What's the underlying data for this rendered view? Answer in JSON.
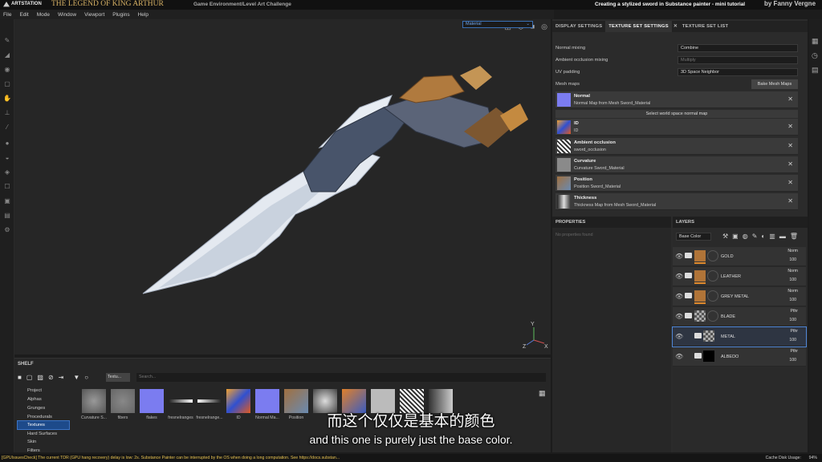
{
  "title_bar": {
    "brand": "ARTSTATION",
    "show": "THE LEGEND OF KING ARTHUR",
    "subtitle": "Game Environment/Level Art Challenge",
    "tutorial": "Creating a stylized sword in Substance painter - mini tutorial",
    "author": "by Fanny Vergne"
  },
  "menu": [
    "File",
    "Edit",
    "Mode",
    "Window",
    "Viewport",
    "Plugins",
    "Help"
  ],
  "viewport": {
    "material_select": "Material"
  },
  "tabs": {
    "display": "DISPLAY SETTINGS",
    "texture_set": "TEXTURE SET SETTINGS",
    "texture_list": "TEXTURE SET LIST"
  },
  "settings": {
    "normal_mixing": {
      "label": "Normal mixing",
      "value": "Combine"
    },
    "ao_mixing": {
      "label": "Ambient occlusion mixing",
      "value": "Multiply"
    },
    "uv_padding": {
      "label": "UV padding",
      "value": "3D Space Neighbor"
    },
    "mesh_maps_label": "Mesh maps",
    "bake_button": "Bake Mesh Maps",
    "world_space_button": "Select world space normal map"
  },
  "mesh_maps": [
    {
      "title": "Normal",
      "sub": "Normal Map from Mesh Sword_Material"
    },
    {
      "title": "ID",
      "sub": "ID"
    },
    {
      "title": "Ambient occlusion",
      "sub": "sword_occlusion"
    },
    {
      "title": "Curvature",
      "sub": "Curvature Sword_Material"
    },
    {
      "title": "Position",
      "sub": "Position Sword_Material"
    },
    {
      "title": "Thickness",
      "sub": "Thickness Map from Mesh Sword_Material"
    }
  ],
  "properties": {
    "header": "PROPERTIES",
    "empty": "No properties found"
  },
  "layers": {
    "header": "LAYERS",
    "channel": "Base Color",
    "items": [
      {
        "name": "GOLD",
        "blend": "Norm",
        "opacity": "100"
      },
      {
        "name": "LEATHER",
        "blend": "Norm",
        "opacity": "100"
      },
      {
        "name": "GREY METAL",
        "blend": "Norm",
        "opacity": "100"
      },
      {
        "name": "BLADE",
        "blend": "Pthr",
        "opacity": "100"
      },
      {
        "name": "METAL",
        "blend": "Pthr",
        "opacity": "100"
      },
      {
        "name": "ALBEDO",
        "blend": "Pthr",
        "opacity": "100"
      }
    ]
  },
  "shelf": {
    "header": "SHELF",
    "filter_tag": "Textu...",
    "search_placeholder": "Search...",
    "categories": [
      "Project",
      "Alphas",
      "Grunges",
      "Procedurals",
      "Textures",
      "Hard Surfaces",
      "Skin",
      "Filters"
    ],
    "active_category": "Textures",
    "thumbs": [
      "Curvature S...",
      "fibers",
      "flakes",
      "fresnelranges",
      "fresnelrange...",
      "ID",
      "Normal Ma...",
      "Position"
    ]
  },
  "subtitles": {
    "cn": "而这个仅仅是基本的颜色",
    "en": "and this one is purely just the base color."
  },
  "status": {
    "message": "[GPUIssuesCheck] The current TDR (GPU hang recovery) delay is low: 2s. Substance Painter can be interrupted by the OS when doing a long computation. See https://docs.substan...",
    "cache": "Cache Disk Usage:",
    "cache_value": "94%"
  }
}
